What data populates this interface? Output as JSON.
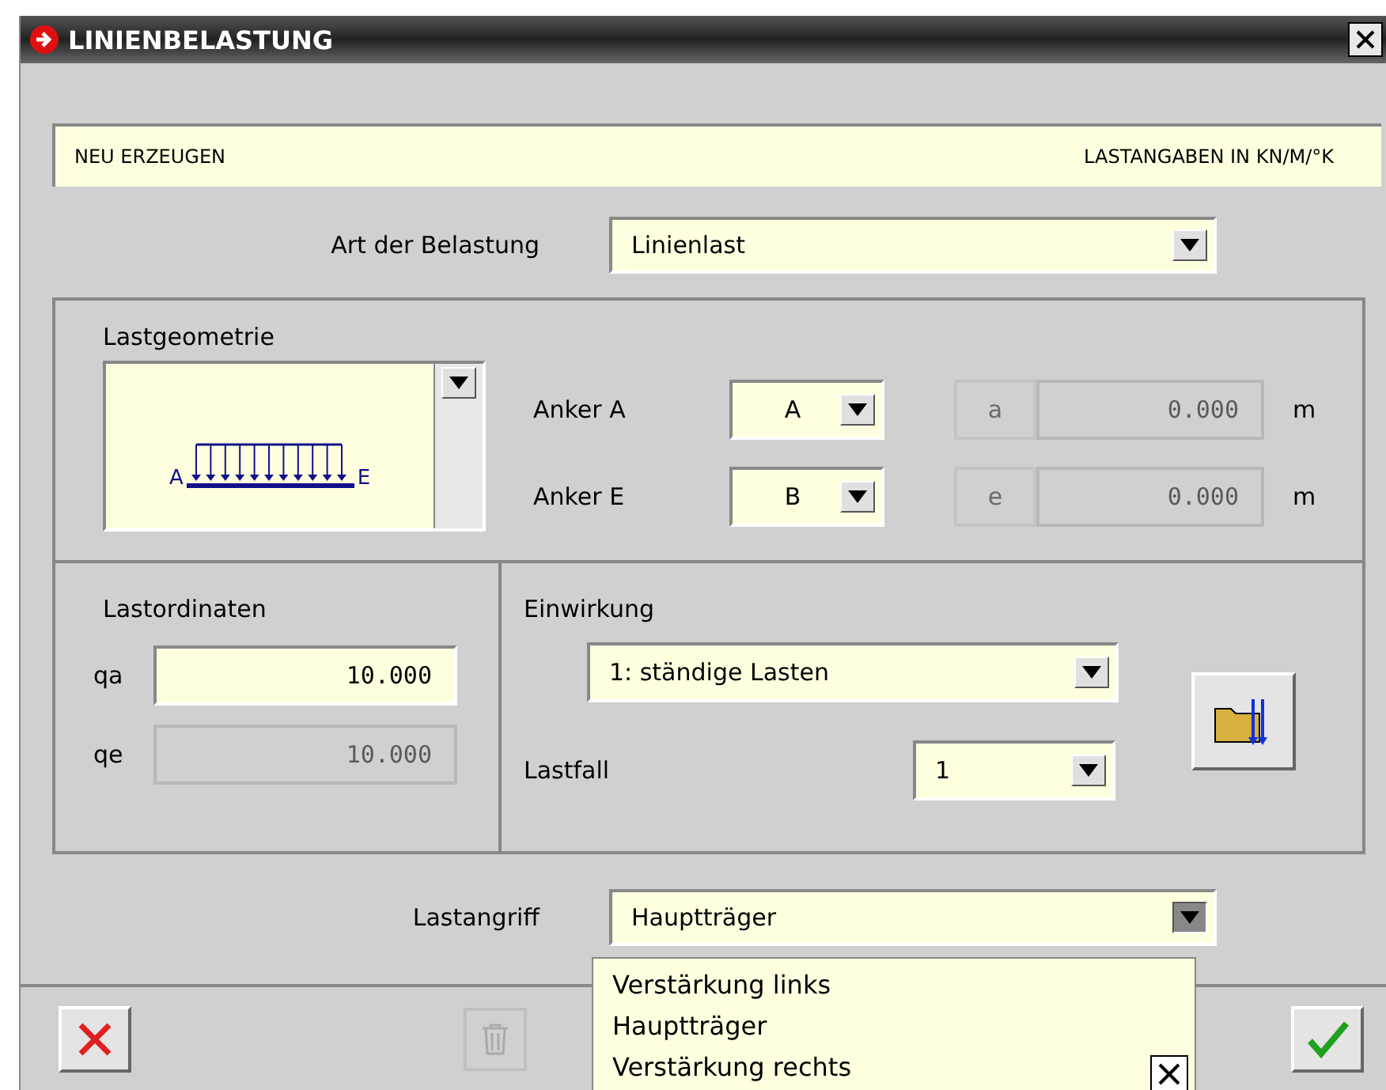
{
  "window": {
    "title": "LINIENBELASTUNG"
  },
  "info_bar": {
    "mode": "NEU ERZEUGEN",
    "units": "LASTANGABEN IN KN/M/°K"
  },
  "load_type": {
    "label": "Art der Belastung",
    "value": "Linienlast"
  },
  "geometry": {
    "title": "Lastgeometrie",
    "start_label": "A",
    "end_label": "E",
    "anchors": [
      {
        "label": "Anker A",
        "value": "A",
        "offset_label": "a",
        "offset_value": "0.000",
        "unit": "m",
        "disabled": true
      },
      {
        "label": "Anker E",
        "value": "B",
        "offset_label": "e",
        "offset_value": "0.000",
        "unit": "m",
        "disabled": true
      }
    ]
  },
  "ordinates": {
    "title": "Lastordinaten",
    "fields": [
      {
        "label": "qa",
        "value": "10.000",
        "disabled": false
      },
      {
        "label": "qe",
        "value": "10.000",
        "disabled": true
      }
    ]
  },
  "action": {
    "title": "Einwirkung",
    "value": "1: ständige Lasten",
    "load_case_label": "Lastfall",
    "load_case": "1"
  },
  "load_application": {
    "label": "Lastangriff",
    "value": "Hauptträger",
    "open": true,
    "options": [
      "Verstärkung links",
      "Hauptträger",
      "Verstärkung rechts"
    ]
  },
  "buttons": [
    {
      "kind": "cancel",
      "disabled": false
    },
    {
      "kind": "delete",
      "disabled": true
    },
    {
      "kind": "ok",
      "disabled": false
    }
  ]
}
